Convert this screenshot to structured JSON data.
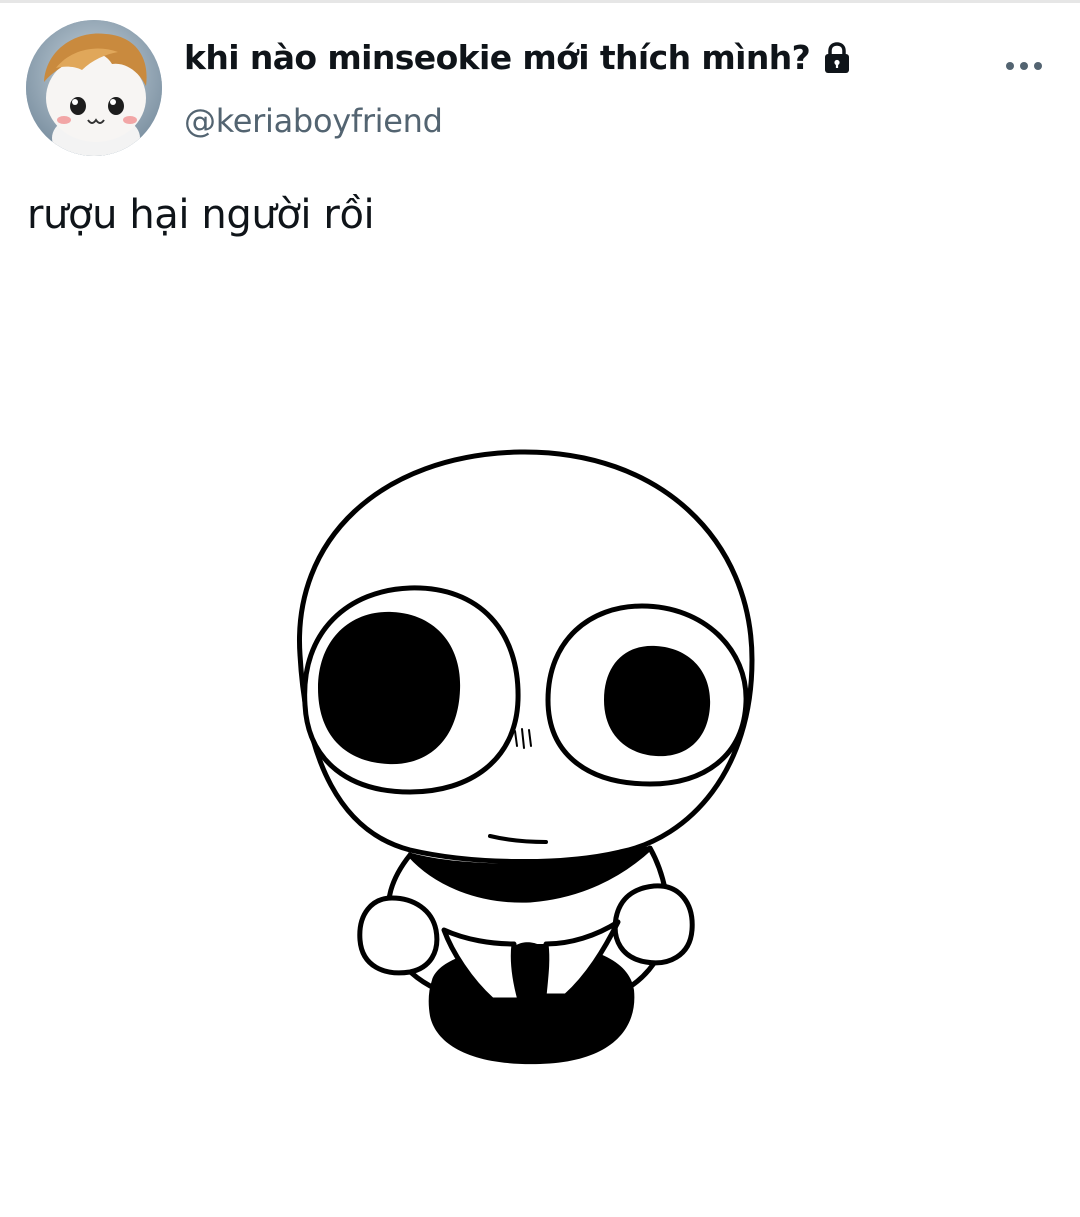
{
  "tweet": {
    "author": {
      "display_name": "khi nào minseokie mới thích mình?",
      "handle": "@keriaboyfriend",
      "protected_icon": "lock-icon",
      "avatar_icon": "plush-toy-avatar"
    },
    "more_icon": "more-dots-icon",
    "text": "rượu hại người rồi",
    "media_icon": "cartoon-character-illustration"
  }
}
